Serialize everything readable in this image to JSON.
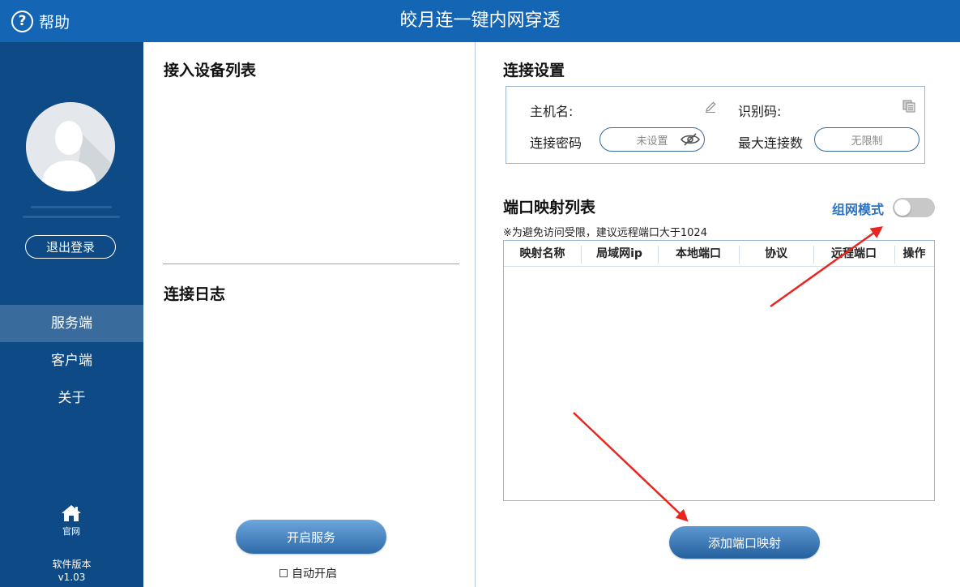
{
  "header": {
    "help_icon_glyph": "?",
    "help_label": "帮助",
    "title": "皎月连一键内网穿透"
  },
  "sidebar": {
    "logout_label": "退出登录",
    "nav": [
      {
        "label": "服务端",
        "active": true
      },
      {
        "label": "客户端",
        "active": false
      },
      {
        "label": "关于",
        "active": false
      }
    ],
    "home_label": "官网",
    "version_label": "软件版本",
    "version_value": "v1.03"
  },
  "middle": {
    "devices_title": "接入设备列表",
    "log_title": "连接日志",
    "start_button": "开启服务",
    "autostart_label": "自动开启",
    "autostart_checked": false
  },
  "settings": {
    "title": "连接设置",
    "hostname_label": "主机名:",
    "hostname_value": "",
    "id_label": "识别码:",
    "id_value": "",
    "password_label": "连接密码",
    "password_placeholder": "未设置",
    "max_conn_label": "最大连接数",
    "max_conn_value": "无限制"
  },
  "port_mapping": {
    "title": "端口映射列表",
    "mode_label": "组网模式",
    "mode_enabled": false,
    "hint": "※为避免访问受限，建议远程端口大于1024",
    "columns": [
      "映射名称",
      "局域网ip",
      "本地端口",
      "协议",
      "远程端口",
      "操作"
    ],
    "rows": [],
    "add_button": "添加端口映射"
  },
  "colors": {
    "header_bg": "#1565b5",
    "sidebar_bg": "#0e4a86",
    "nav_active_bg": "#3a6b9d",
    "accent_text": "#2b73c2",
    "annotation_arrow": "#e8261f"
  },
  "icons": {
    "help": "question-circle-icon",
    "avatar": "user-silhouette-icon",
    "home": "house-icon",
    "hostname_edit": "pencil-icon",
    "id_copy": "copy-icon",
    "password_visibility": "eye-slash-icon"
  }
}
